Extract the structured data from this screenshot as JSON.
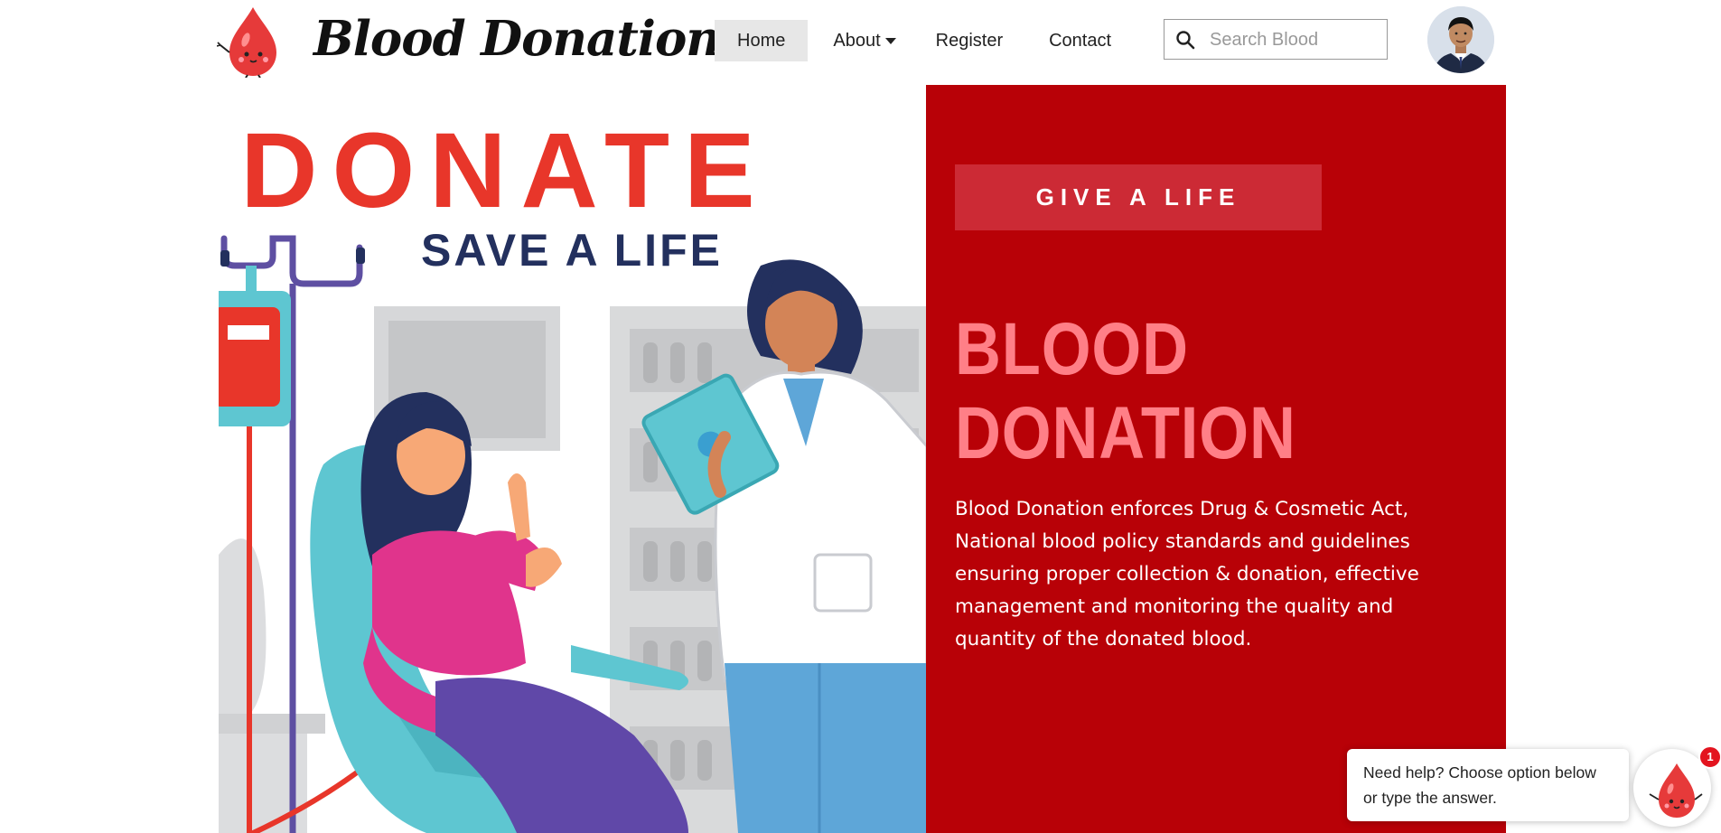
{
  "header": {
    "brand": "Blood Donation",
    "logo_icon": "blood-drop-mascot-icon",
    "nav": [
      {
        "label": "Home",
        "active": true
      },
      {
        "label": "About",
        "has_dropdown": true
      },
      {
        "label": "Register"
      },
      {
        "label": "Contact"
      }
    ],
    "search": {
      "placeholder": "Search Blood",
      "value": ""
    },
    "avatar_icon": "user-avatar"
  },
  "hero": {
    "illustration": {
      "headline": "DONATE",
      "subheadline": "SAVE A LIFE"
    },
    "cta_label": "GIVE A LIFE",
    "title_line1": "BLOOD",
    "title_line2": "DONATION",
    "description": "Blood Donation enforces Drug & Cosmetic Act, National blood policy standards and guidelines ensuring proper collection & donation, effective management and monitoring the quality and quantity of the donated blood."
  },
  "chat": {
    "message": "Need help? Choose option below or type the answer.",
    "badge": "1",
    "launcher_icon": "blood-drop-mascot-icon"
  },
  "colors": {
    "panel": "#b80107",
    "cta": "#cc2a35",
    "title": "#ff7f87",
    "donate_red": "#e8362a",
    "navy": "#23305e"
  }
}
